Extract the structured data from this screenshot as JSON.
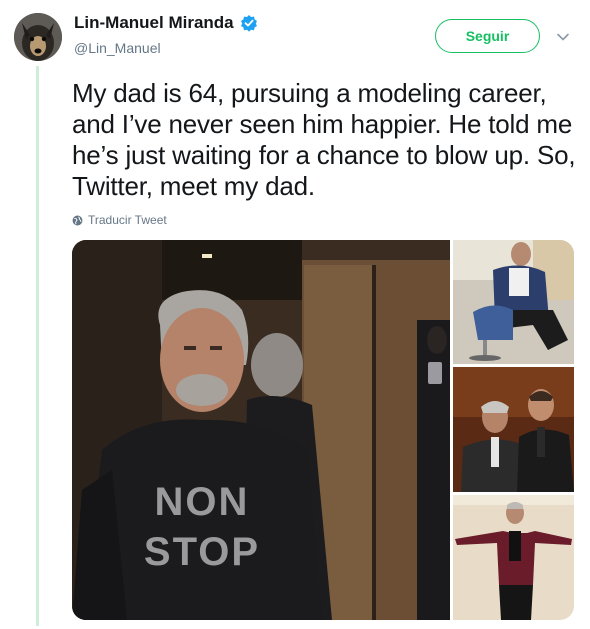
{
  "tweet": {
    "author_name": "Lin-Manuel Miranda",
    "author_handle": "@Lin_Manuel",
    "verified": true,
    "follow_label": "Seguir",
    "text": "My dad is 64, pursuing a modeling career, and I’ve never seen him happier. He told me he’s just waiting for a chance to blow up. So, Twitter, meet my dad.",
    "translate_label": "Traducir Tweet",
    "photo_count": 4
  },
  "shirt_text": {
    "line1": "NON",
    "line2": "STOP"
  },
  "colors": {
    "accent_green": "#17bf63",
    "verified_blue": "#1da1f2",
    "secondary_text": "#657786",
    "thread_line": "#cdeedb"
  },
  "icons": {
    "verified": "verified-badge-icon",
    "caret": "chevron-down-icon",
    "translate": "globe-icon"
  }
}
